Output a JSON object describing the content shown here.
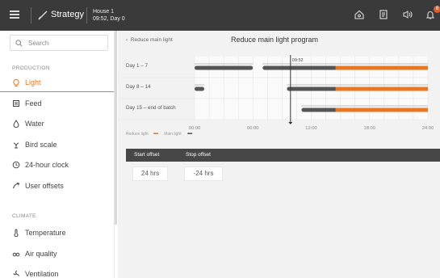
{
  "header": {
    "app_title": "Strategy",
    "house": "House 1",
    "time_day": "09:52, Day 0",
    "alarm_count": "8"
  },
  "sidebar": {
    "search_placeholder": "Search",
    "production_label": "PRODUCTION",
    "production_items": [
      {
        "label": "Light",
        "icon": "bulb-icon",
        "active": true
      },
      {
        "label": "Feed",
        "icon": "feed-icon"
      },
      {
        "label": "Water",
        "icon": "drop-icon"
      },
      {
        "label": "Bird scale",
        "icon": "bird-scale-icon"
      },
      {
        "label": "24-hour clock",
        "icon": "clock-icon"
      },
      {
        "label": "User offsets",
        "icon": "offset-icon"
      }
    ],
    "climate_label": "CLIMATE",
    "climate_items": [
      {
        "label": "Temperature",
        "icon": "thermometer-icon"
      },
      {
        "label": "Air quality",
        "icon": "co2-icon"
      },
      {
        "label": "Ventilation",
        "icon": "fan-icon"
      }
    ]
  },
  "main": {
    "breadcrumb": "Reduce main light",
    "title": "Reduce main light program",
    "table": {
      "headers": [
        "Start offset",
        "Stop offset"
      ],
      "values": [
        "24 hrs",
        "-24 hrs"
      ]
    }
  },
  "colors": {
    "accent": "#e87722",
    "reduce": "#e87722",
    "main": "#555555"
  },
  "chart_data": {
    "type": "timeline",
    "current_time": "09:52",
    "x_ticks": [
      "00:00",
      "06:00",
      "12:00",
      "18:00",
      "24:00"
    ],
    "legend": [
      {
        "name": "Reduce light",
        "color": "#e87722"
      },
      {
        "name": "Main light",
        "color": "#555555"
      }
    ],
    "rows": [
      {
        "label": "Day 1 – 7",
        "main": [
          [
            0,
            6
          ],
          [
            7,
            24
          ]
        ],
        "reduce": [
          [
            14.5,
            24
          ]
        ]
      },
      {
        "label": "Day 8 – 14",
        "main": [
          [
            0,
            1
          ],
          [
            9.5,
            24
          ]
        ],
        "reduce": [
          [
            14.5,
            24
          ]
        ]
      },
      {
        "label": "Day 15 – end of batch",
        "main": [
          [
            11,
            24
          ]
        ],
        "reduce": [
          [
            14.5,
            24
          ]
        ]
      }
    ]
  }
}
